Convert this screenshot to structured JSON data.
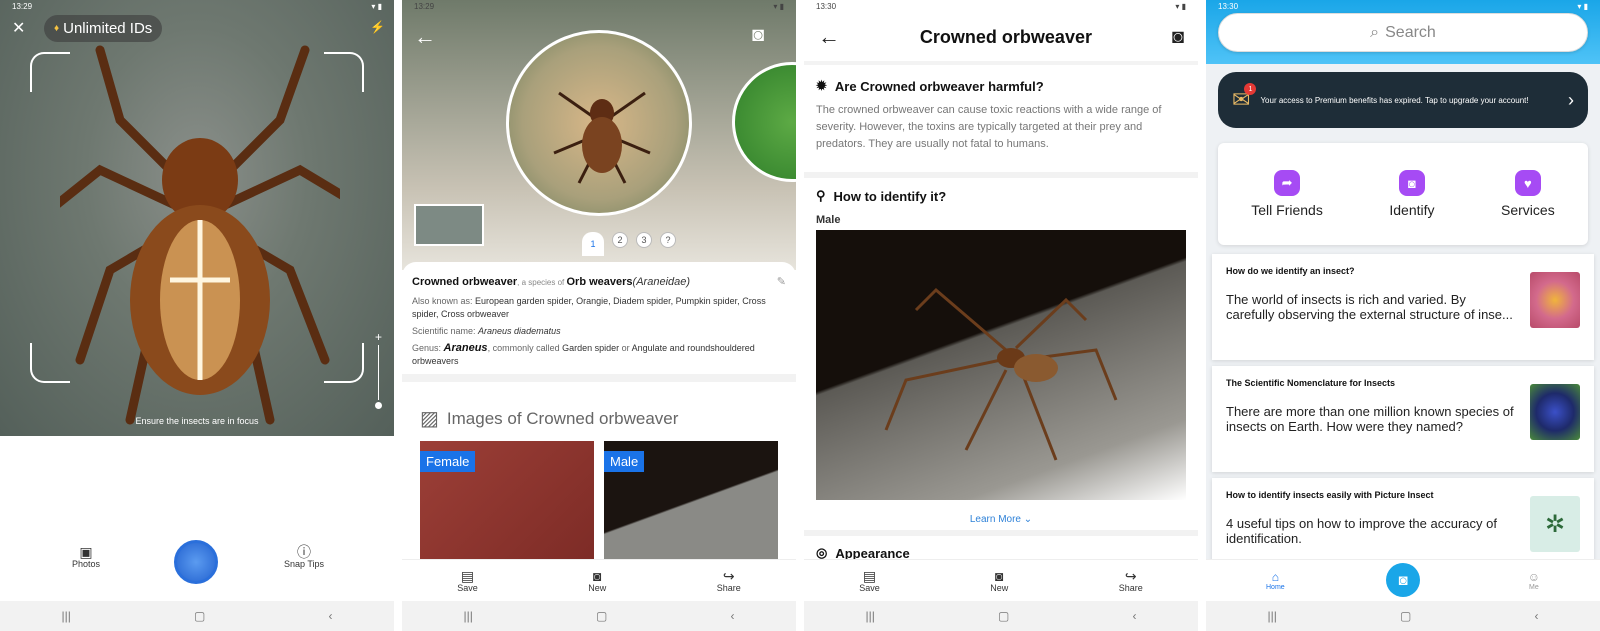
{
  "screen1": {
    "status_time": "13:29",
    "premium_pill": "Unlimited IDs",
    "focus_hint": "Ensure the insects are in focus",
    "photos_label": "Photos",
    "snap_tips_label": "Snap Tips"
  },
  "screen2": {
    "status_time": "13:29",
    "page_dots": [
      "1",
      "2",
      "3",
      "?"
    ],
    "name": "Crowned orbweaver",
    "species_of": ", a species of ",
    "family_name": "Orb weavers",
    "family_latin": "(Araneidae)",
    "aka_label": "Also known as: ",
    "aka_value": "European garden spider, Orangie, Diadem spider, Pumpkin spider, Cross spider, Cross orbweaver",
    "sci_label": "Scientific name: ",
    "sci_value": "Araneus diadematus",
    "genus_label": "Genus: ",
    "genus_value": "Araneus",
    "commonly_called": ", commonly called ",
    "common_1": "Garden spider",
    "or_text": " or ",
    "common_2": "Angulate and roundshouldered orbweavers",
    "images_title": "Images of Crowned orbweaver",
    "tag_female": "Female",
    "tag_male": "Male",
    "save": "Save",
    "new": "New",
    "share": "Share"
  },
  "screen3": {
    "status_time": "13:30",
    "title": "Crowned orbweaver",
    "harmful_heading": "Are Crowned orbweaver harmful?",
    "harmful_text": "The crowned orbweaver can cause toxic reactions with a wide range of severity. However, the toxins are typically targeted at their prey and predators. They are usually not fatal to humans.",
    "identify_heading": "How to identify it?",
    "male_label": "Male",
    "learn_more": "Learn More",
    "appearance_heading": "Appearance",
    "save": "Save",
    "new": "New",
    "share": "Share"
  },
  "screen4": {
    "status_time": "13:30",
    "search_placeholder": "Search",
    "badge_count": "1",
    "premium_banner": "Your access to Premium benefits has expired. Tap to upgrade your account!",
    "quick_actions": [
      "Tell Friends",
      "Identify",
      "Services"
    ],
    "articles": [
      {
        "title": "How do we identify an insect?",
        "desc": "The world of insects is rich and varied. By carefully observing the external structure of inse..."
      },
      {
        "title": "The Scientific Nomenclature for Insects",
        "desc": "There are more than one million known species of insects on Earth. How were they named?"
      },
      {
        "title": "How to identify insects easily with Picture Insect",
        "desc": "4 useful tips on how to improve the accuracy of identification."
      }
    ],
    "tab_home": "Home",
    "tab_me": "Me"
  },
  "colors": {
    "accent": "#1a73e8",
    "purple": "#a64bf4",
    "banner": "#1e2d38"
  }
}
